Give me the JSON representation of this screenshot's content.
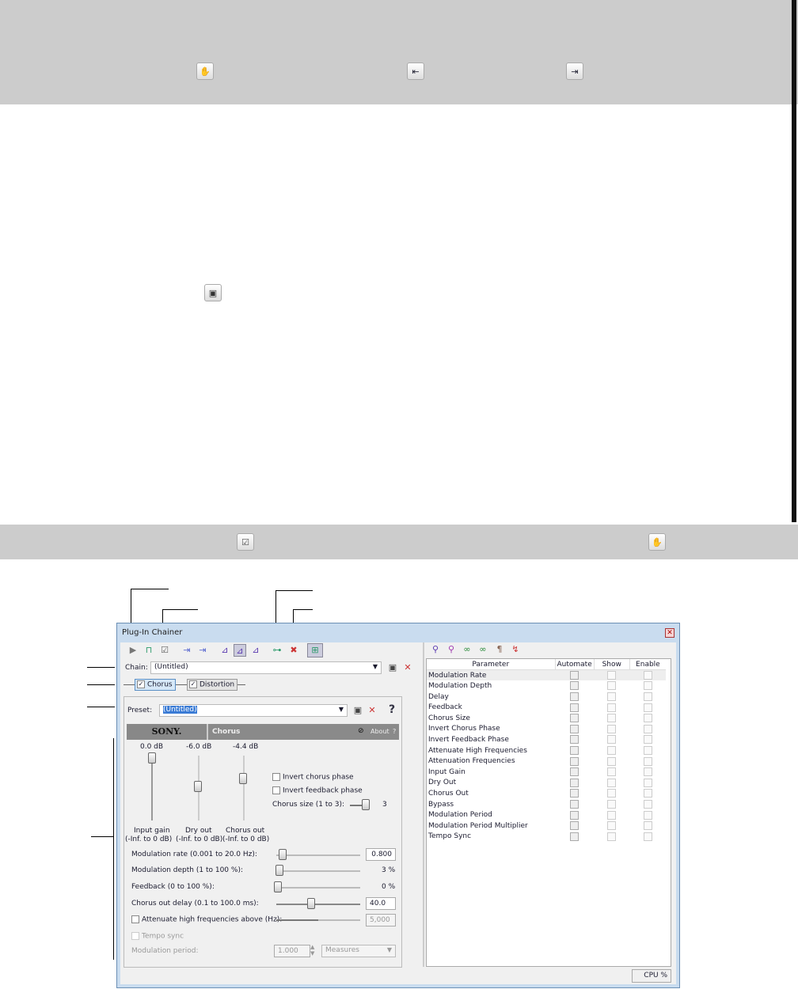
{
  "top_band": {
    "icons": [
      "event-pan-crop-icon",
      "move-left-icon",
      "move-right-icon"
    ]
  },
  "middle": {
    "icons": [
      "save-icon"
    ]
  },
  "second_band": {
    "icons": [
      "bypass-fx-icon",
      "event-pan-crop-icon"
    ]
  },
  "window": {
    "title": "Plug-In Chainer",
    "toolbar_icons": [
      "play-icon",
      "plugin-icon",
      "bypass-icon",
      "move-left-icon",
      "move-right-icon",
      "pre-volume-icon",
      "post-volume-icon",
      "envelope-icon",
      "add-plugin-icon",
      "remove-plugin-icon",
      "plugin-chain-icon"
    ],
    "chain_label": "Chain:",
    "chain_value": "(Untitled)",
    "plugins": [
      {
        "label": "Chorus",
        "checked": true,
        "active": true
      },
      {
        "label": "Distortion",
        "checked": true,
        "active": false
      }
    ],
    "preset_label": "Preset:",
    "preset_value": "(Untitled)",
    "help": "?",
    "plugin_header": {
      "brand": "SONY.",
      "name": "Chorus",
      "about": "About",
      "help": "?"
    },
    "faders": [
      {
        "value": "0.0 dB",
        "label": "Input gain",
        "range": "(-Inf. to 0 dB)",
        "level": 1.0
      },
      {
        "value": "-6.0 dB",
        "label": "Dry out",
        "range": "(-Inf. to 0 dB)",
        "level": 0.55
      },
      {
        "value": "-4.4 dB",
        "label": "Chorus out",
        "range": "(-Inf. to 0 dB)",
        "level": 0.65
      }
    ],
    "invert_chorus": "Invert chorus phase",
    "invert_feedback": "Invert feedback phase",
    "chorus_size_label": "Chorus size (1 to 3):",
    "chorus_size_value": "3",
    "params": [
      {
        "label": "Modulation rate (0.001 to 20.0 Hz):",
        "value": "0.800",
        "pos": 0.04
      },
      {
        "label": "Modulation depth (1 to 100 %):",
        "value": "3 %",
        "pos": 0.02
      },
      {
        "label": "Feedback (0 to 100 %):",
        "value": "0 %",
        "pos": 0.0
      },
      {
        "label": "Chorus out delay (0.1 to 100.0 ms):",
        "value": "40.0",
        "pos": 0.4
      },
      {
        "label": "Attenuate high frequencies above (Hz):",
        "value": "5,000",
        "pos": 0.5
      }
    ],
    "tempo_sync": "Tempo sync",
    "mod_period_label": "Modulation period:",
    "mod_period_value": "1.000",
    "mod_period_unit": "Measures",
    "right_toolbar_icons": [
      "automation-icon",
      "remove-automation-icon",
      "show-icon",
      "hide-icon",
      "enable-icon",
      "disable-icon"
    ],
    "table": {
      "headers": [
        "Parameter",
        "Automate",
        "Show",
        "Enable"
      ],
      "rows": [
        "Modulation Rate",
        "Modulation Depth",
        "Delay",
        "Feedback",
        "Chorus Size",
        "Invert Chorus Phase",
        "Invert Feedback Phase",
        "Attenuate High Frequencies",
        "Attenuation Frequencies",
        "Input Gain",
        "Dry Out",
        "Chorus Out",
        "Bypass",
        "Modulation Period",
        "Modulation Period Multiplier",
        "Tempo Sync"
      ]
    },
    "status": "CPU %"
  }
}
